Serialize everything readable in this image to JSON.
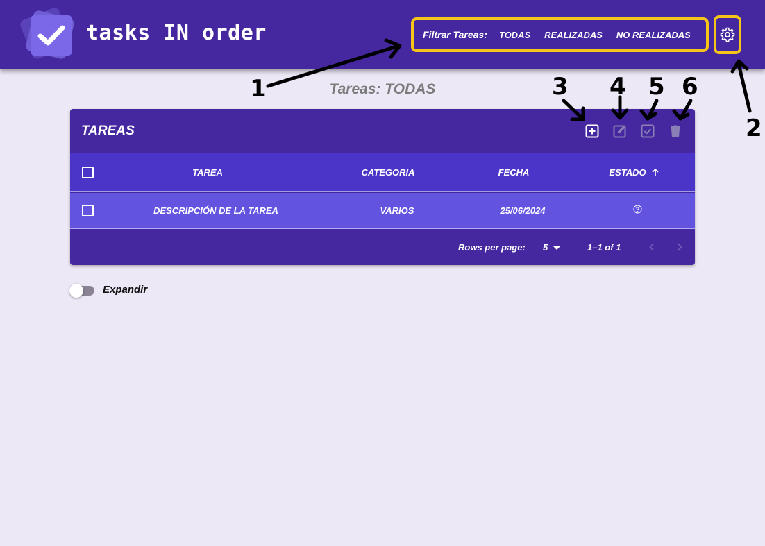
{
  "app": {
    "title": "tasks IN order"
  },
  "filter": {
    "label": "Filtrar Tareas:",
    "options": [
      "TODAS",
      "REALIZADAS",
      "NO REALIZADAS"
    ]
  },
  "page": {
    "subtitle": "Tareas: TODAS"
  },
  "table": {
    "title": "TAREAS",
    "columns": [
      "TAREA",
      "CATEGORIA",
      "FECHA",
      "ESTADO"
    ],
    "sort_icon": "arrow-up-icon",
    "rows": [
      {
        "tarea": "DESCRIPCIÓN DE LA TAREA",
        "categoria": "VARIOS",
        "fecha": "25/06/2024",
        "estado_icon": "help-circle-icon"
      }
    ],
    "footer": {
      "rows_per_page_label": "Rows per page:",
      "rows_per_page_value": "5",
      "range": "1–1 of 1"
    }
  },
  "toolbar_icons": [
    "add-box-icon",
    "edit-icon",
    "check-box-icon",
    "delete-icon"
  ],
  "expand": {
    "label": "Expandir"
  },
  "annotations": [
    "1",
    "2",
    "3",
    "4",
    "5",
    "6"
  ],
  "colors": {
    "header": "#4527a0",
    "header_row": "#4b35c8",
    "data_row": "#6354e0",
    "highlight": "#f5c518",
    "background": "#ede8f5"
  }
}
